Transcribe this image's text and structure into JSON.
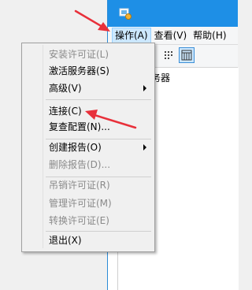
{
  "menubar": {
    "items": [
      "操作(A)",
      "查看(V)",
      "帮助(H)"
    ]
  },
  "tree": {
    "node_label": "所有服务器"
  },
  "menu": {
    "items": [
      {
        "label": "安装许可证(L)",
        "enabled": false,
        "submenu": false
      },
      {
        "label": "激活服务器(S)",
        "enabled": true,
        "submenu": false
      },
      {
        "label": "高级(V)",
        "enabled": true,
        "submenu": true
      },
      {
        "label": "连接(C)",
        "enabled": true,
        "submenu": false
      },
      {
        "label": "复查配置(N)...",
        "enabled": true,
        "submenu": false
      },
      {
        "label": "创建报告(O)",
        "enabled": true,
        "submenu": true
      },
      {
        "label": "删除报告(D)...",
        "enabled": false,
        "submenu": false
      },
      {
        "label": "吊销许可证(R)",
        "enabled": false,
        "submenu": false
      },
      {
        "label": "管理许可证(M)",
        "enabled": false,
        "submenu": false
      },
      {
        "label": "转换许可证(E)",
        "enabled": false,
        "submenu": false
      },
      {
        "label": "退出(X)",
        "enabled": true,
        "submenu": false
      }
    ]
  },
  "icons": {
    "app": "license-manager-icon",
    "toolbar": [
      "list-view-icon",
      "details-view-icon"
    ]
  },
  "colors": {
    "title_bar": "#1e8fe6",
    "menu_highlight": "#cce8ff",
    "annotation_arrow": "#e8303a"
  }
}
